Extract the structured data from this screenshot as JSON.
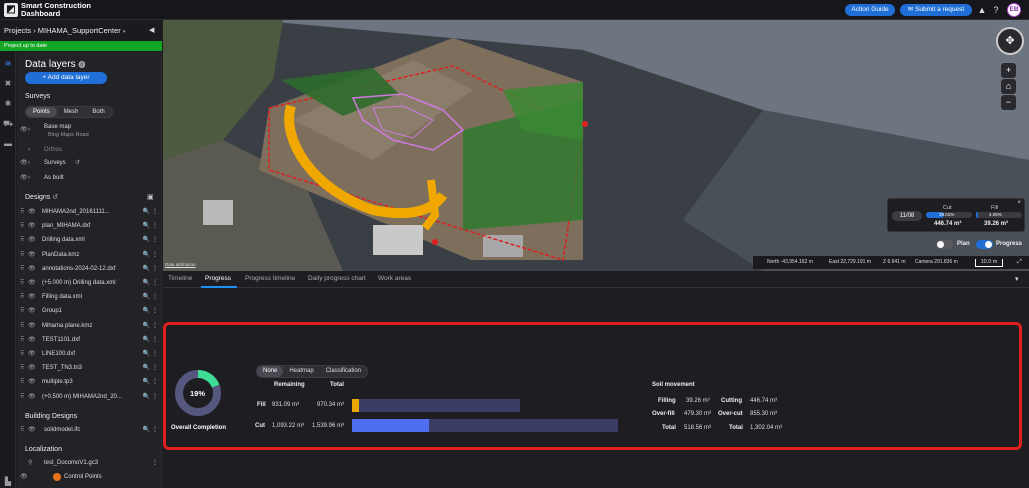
{
  "app": {
    "logo_glyph": "◩",
    "name_line1": "Smart Construction",
    "name_line2": "Dashboard",
    "action_guide": "Action Guide",
    "submit_request": "Submit a request",
    "user_initials": "EB"
  },
  "project": {
    "breadcrumb_root": "Projects",
    "breadcrumb_sep": "›",
    "name": "MIHAMA_SupportCenter",
    "status": "Project up to date"
  },
  "panel": {
    "title": "Data layers",
    "add_button": "+ Add data layer",
    "surveys_title": "Surveys",
    "survey_modes": [
      "Points",
      "Mesh",
      "Both"
    ],
    "survey_mode_selected": "Points",
    "survey_items": [
      {
        "label": "Base map",
        "sub": "Bing Maps Road"
      },
      {
        "label": "Orthos",
        "sub": ""
      },
      {
        "label": "Surveys",
        "sub": ""
      },
      {
        "label": "As built",
        "sub": ""
      }
    ],
    "designs_title": "Designs",
    "designs": [
      "MIHAMA2nd_20161111...",
      "plan_MIHAMA.dxf",
      "Drilling data.xml",
      "PlanData.kmz",
      "annotations-2024-02-12.dxf",
      "(+5.000 m) Drilling data.xml",
      "Filling data.xml",
      "Group1",
      "Mihama plane.kmz",
      "TEST1101.dxf",
      "LINE100.dxf",
      "TEST_TN3.tn3",
      "multiple.tp3",
      "(+0.500 m) MIHAMA2nd_20..."
    ],
    "building_title": "Building Designs",
    "building_item": "solidmodel.ifc",
    "localization_title": "Localization",
    "localization_item": "test_DocomoV1.gc3",
    "control_points": "Control Points"
  },
  "map": {
    "data_attribution": "Data attribution",
    "coords": {
      "north": "North -43,954.162 m",
      "east": "East 22,729.191 m",
      "z": "Z 6.941 m",
      "camera": "Camera 291.836 m",
      "scale": "10.0 m"
    },
    "cut_fill": {
      "date": "11/08",
      "cut_label": "Cut",
      "cut_pct": "39.01%",
      "cut_value": "446.74 m³",
      "fill_label": "Fill",
      "fill_pct": "4.05%",
      "fill_value": "39.26 m³",
      "cut_fraction": 0.3901,
      "fill_fraction": 0.0405
    },
    "plan_toggle": "Plan",
    "progress_toggle": "Progress"
  },
  "tabs": [
    "Timeline",
    "Progress",
    "Progress timeline",
    "Daily progress chart",
    "Work areas"
  ],
  "active_tab": "Progress",
  "progress": {
    "completion_pct_label": "19%",
    "completion_fraction": 0.19,
    "completion_caption": "Overall Completion",
    "view_modes": [
      "None",
      "Heatmap",
      "Classification"
    ],
    "view_selected": "None",
    "col_remaining": "Remaining",
    "col_total": "Total",
    "fill": {
      "label": "Fill",
      "remaining": "931.09 m³",
      "total": "970.34 m³",
      "done_fraction": 0.04
    },
    "cut": {
      "label": "Cut",
      "remaining": "1,093.22 m³",
      "total": "1,539.96 m³",
      "done_fraction": 0.29
    },
    "soil_title": "Soil movement",
    "soil": {
      "filling_label": "Filling",
      "filling": "39.26 m³",
      "cutting_label": "Cutting",
      "cutting": "446.74 m³",
      "overfill_label": "Over-fill",
      "overfill": "479.30 m³",
      "overcut_label": "Over-cut",
      "overcut": "855.30 m³",
      "total_label": "Total",
      "total_fill": "518.56 m³",
      "total_label_2": "Total",
      "total_cut": "1,302.04 m³"
    }
  },
  "colors": {
    "accent": "#1f6fd6",
    "status_green": "#13a524",
    "fill_bar": "#e8a800",
    "cut_bar": "#4f6ff0",
    "donut_done": "#3ddc97",
    "highlight_frame": "#e0201f"
  }
}
